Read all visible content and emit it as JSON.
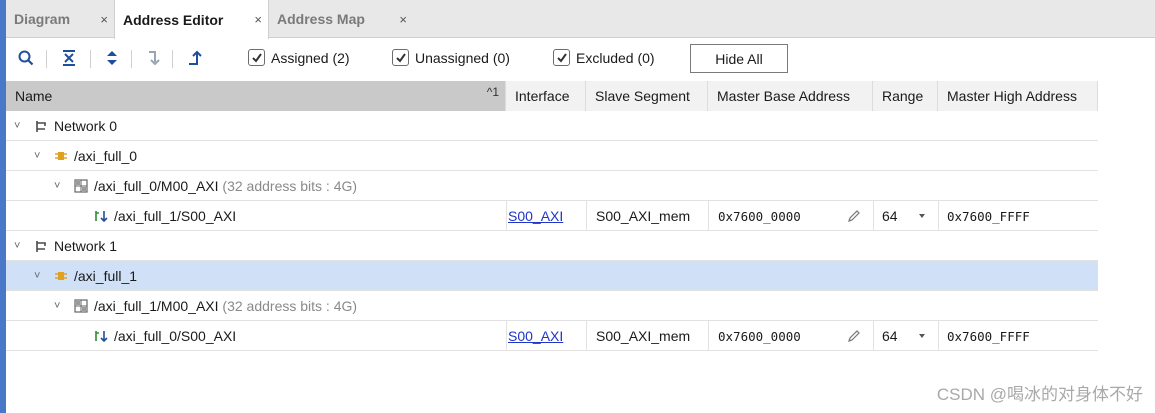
{
  "tabs": [
    {
      "label": "Diagram",
      "close": "×",
      "active": false
    },
    {
      "label": "Address Editor",
      "close": "×",
      "active": true
    },
    {
      "label": "Address Map",
      "close": "×",
      "active": false
    }
  ],
  "toolbar": {
    "icons": [
      "search-icon",
      "collapse-all-icon",
      "expand-all-icon",
      "auto-assign-icon",
      "export-icon"
    ],
    "checkboxes": [
      {
        "label": "Assigned (2)",
        "checked": true
      },
      {
        "label": "Unassigned (0)",
        "checked": true
      },
      {
        "label": "Excluded (0)",
        "checked": true
      }
    ],
    "hide_all_label": "Hide All"
  },
  "table": {
    "sort_indicator": "^1",
    "columns": [
      "Name",
      "Interface",
      "Slave Segment",
      "Master Base Address",
      "Range",
      "Master High Address"
    ],
    "rows": [
      {
        "level": 0,
        "expand": "˅",
        "icon": "network-icon",
        "name": "Network 0",
        "suffix": ""
      },
      {
        "level": 1,
        "expand": "˅",
        "icon": "master-icon",
        "name": "/axi_full_0",
        "suffix": ""
      },
      {
        "level": 2,
        "expand": "˅",
        "icon": "address-space-icon",
        "name": "/axi_full_0/M00_AXI",
        "suffix": "(32 address bits : 4G)"
      },
      {
        "level": 3,
        "expand": "",
        "icon": "slave-interface-icon",
        "name": "/axi_full_1/S00_AXI",
        "suffix": "",
        "interface": "S00_AXI",
        "slave_segment": "S00_AXI_mem",
        "base": "0x7600_0000",
        "range": "64",
        "high": "0x7600_FFFF"
      },
      {
        "level": 0,
        "expand": "˅",
        "icon": "network-icon",
        "name": "Network 1",
        "suffix": ""
      },
      {
        "level": 1,
        "expand": "˅",
        "icon": "master-icon",
        "name": "/axi_full_1",
        "suffix": "",
        "selected": true
      },
      {
        "level": 2,
        "expand": "˅",
        "icon": "address-space-icon",
        "name": "/axi_full_1/M00_AXI",
        "suffix": "(32 address bits : 4G)"
      },
      {
        "level": 3,
        "expand": "",
        "icon": "slave-interface-icon",
        "name": "/axi_full_0/S00_AXI",
        "suffix": "",
        "interface": "S00_AXI",
        "slave_segment": "S00_AXI_mem",
        "base": "0x7600_0000",
        "range": "64",
        "high": "0x7600_FFFF"
      }
    ]
  },
  "watermark": "CSDN @喝冰的对身体不好",
  "colors": {
    "accent": "#4a78c9",
    "link": "#1f35c9",
    "selected_row": "#cfe0f7",
    "icon_orange": "#e0a020",
    "icon_green": "#2e8b3a"
  }
}
